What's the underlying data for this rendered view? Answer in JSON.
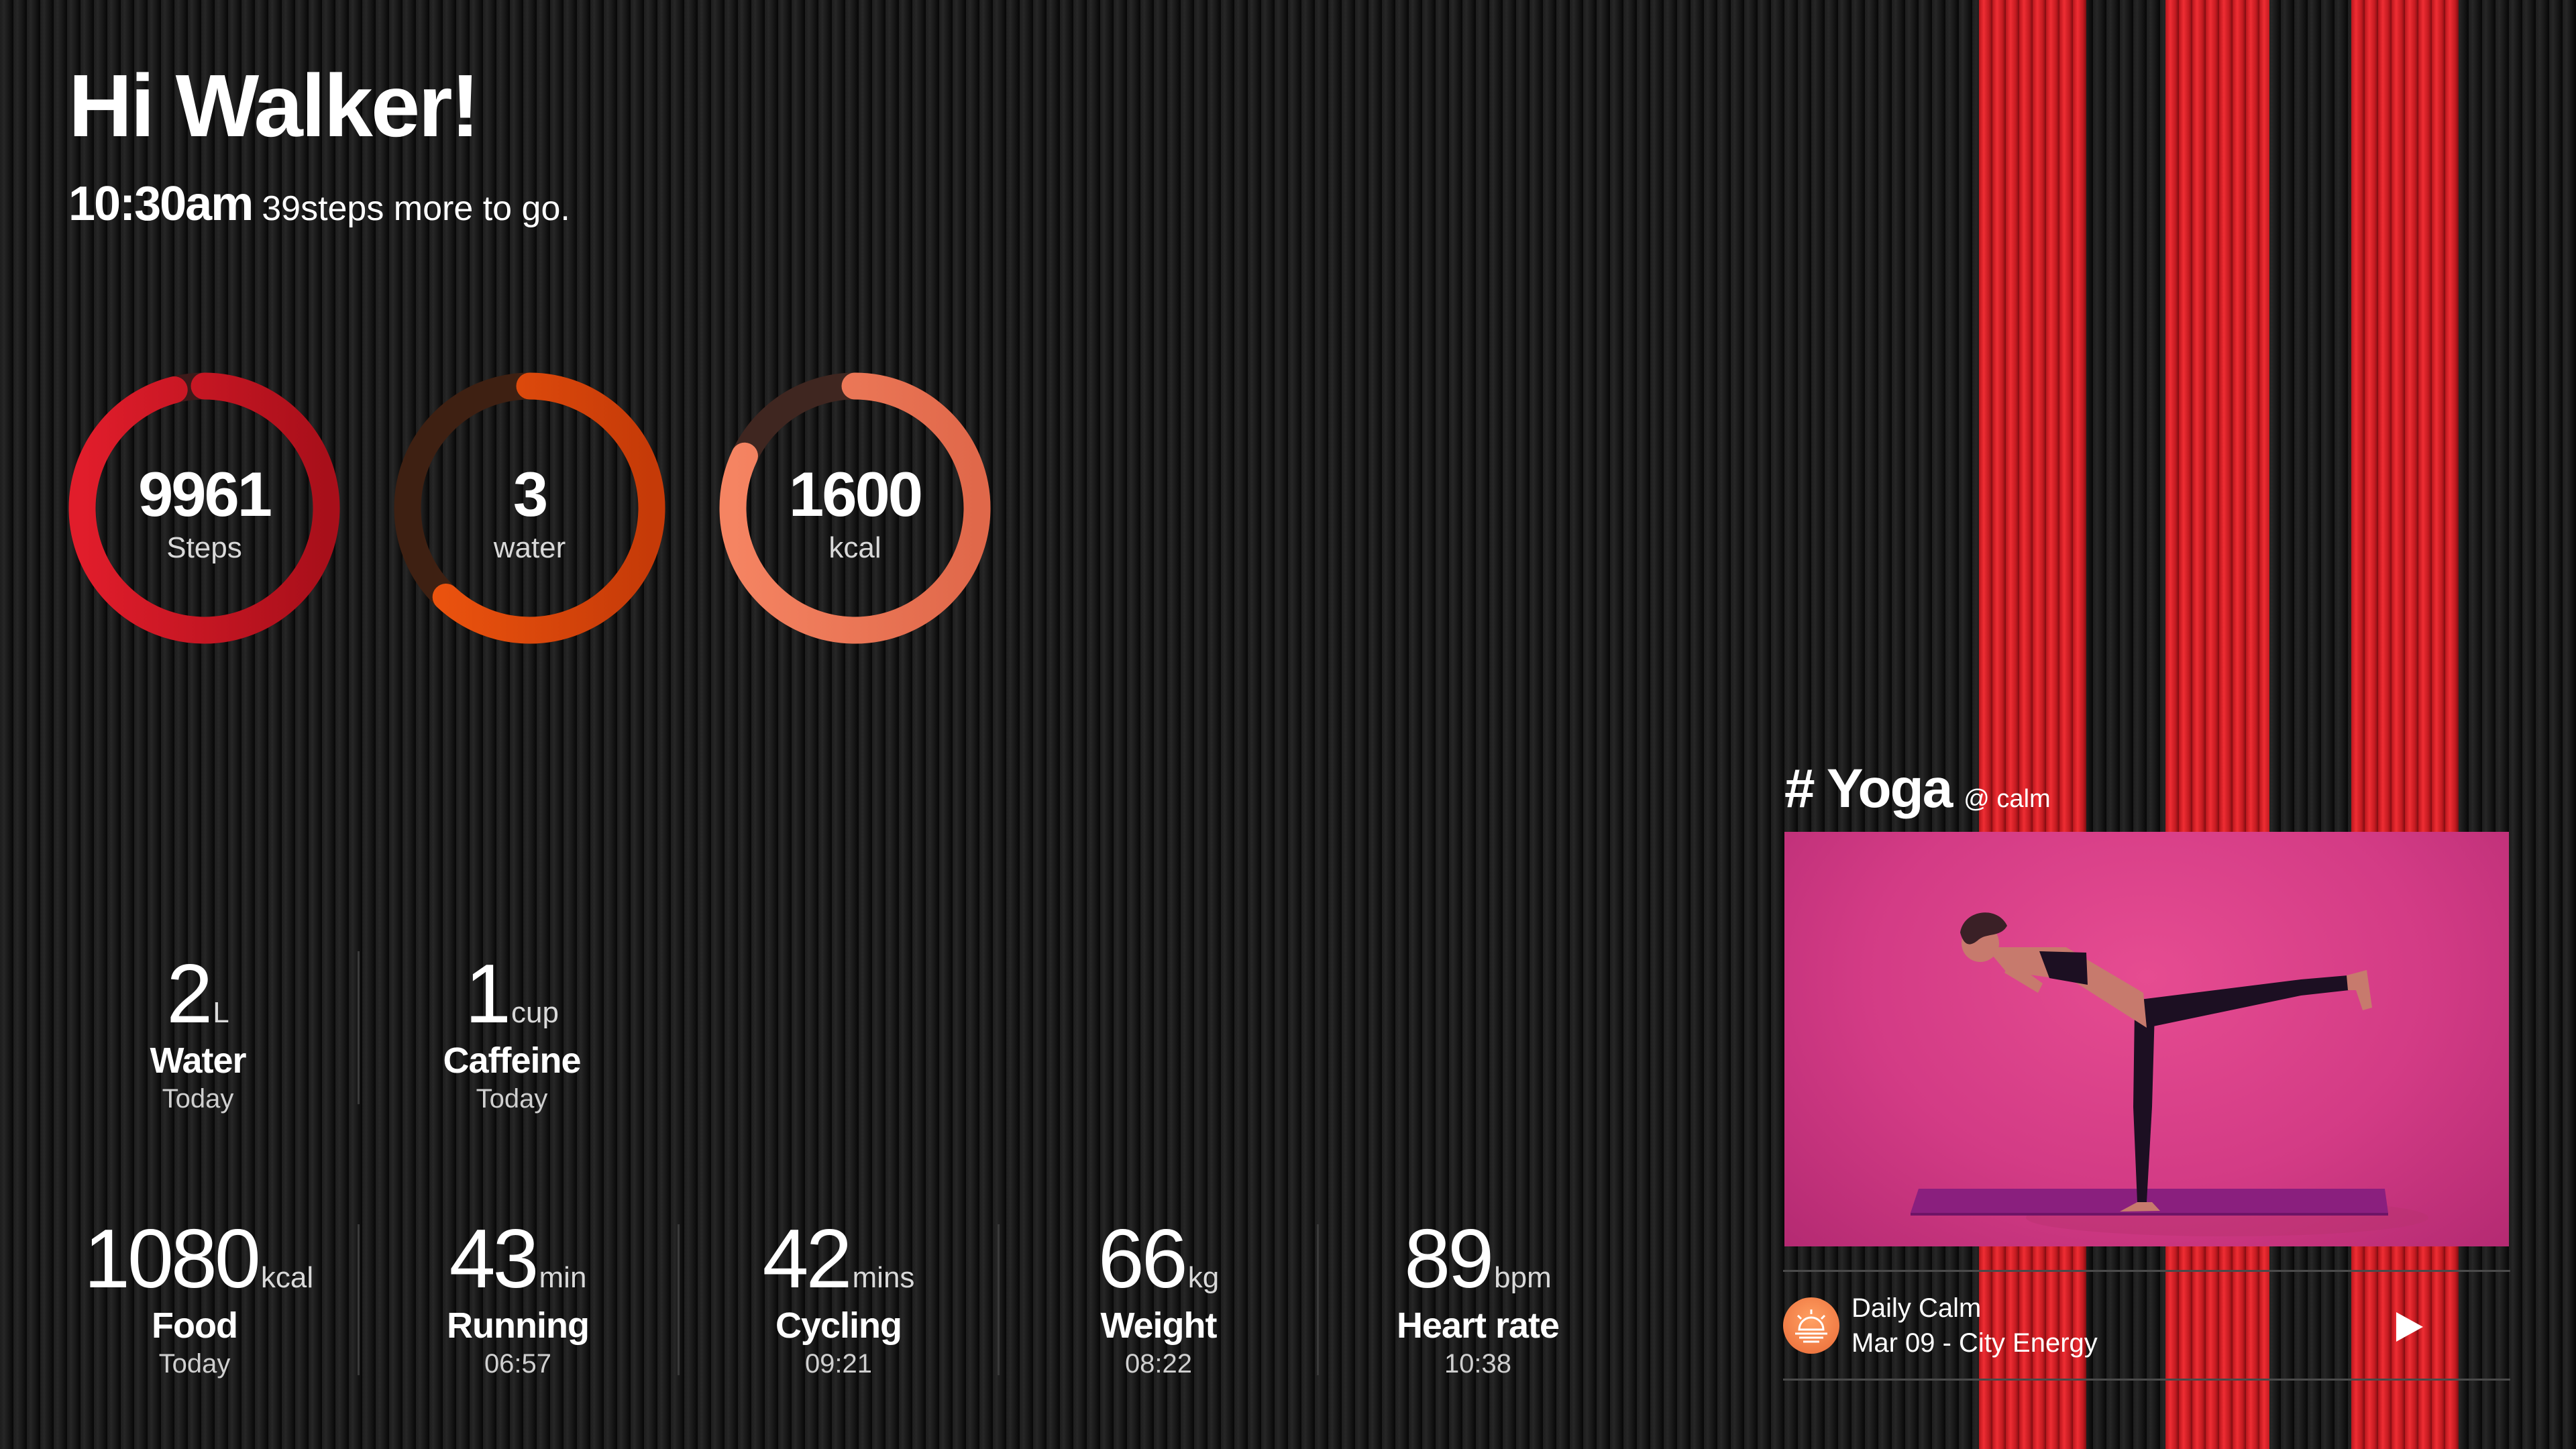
{
  "header": {
    "greeting": "Hi Walker!",
    "time": "10:30am",
    "steps_remaining": "39",
    "steps_text": "steps more to go."
  },
  "rings": [
    {
      "value": "9961",
      "label": "Steps",
      "progress": 0.96,
      "color": "#e11d2b"
    },
    {
      "value": "3",
      "label": "water",
      "progress": 0.62,
      "color": "#e0470d"
    },
    {
      "value": "1600",
      "label": "kcal",
      "progress": 0.82,
      "color": "#f27b55"
    }
  ],
  "stats_top": [
    {
      "value": "2",
      "unit": "L",
      "title": "Water",
      "sub": "Today"
    },
    {
      "value": "1",
      "unit": "cup",
      "title": "Caffeine",
      "sub": "Today"
    }
  ],
  "stats_bottom": [
    {
      "value": "1080",
      "unit": "kcal",
      "title": "Food",
      "sub": "Today"
    },
    {
      "value": "43",
      "unit": "min",
      "title": "Running",
      "sub": "06:57"
    },
    {
      "value": "42",
      "unit": "mins",
      "title": "Cycling",
      "sub": "09:21"
    },
    {
      "value": "66",
      "unit": "kg",
      "title": "Weight",
      "sub": "08:22"
    },
    {
      "value": "89",
      "unit": "bpm",
      "title": "Heart rate",
      "sub": "10:38"
    }
  ],
  "yoga": {
    "tag": "# Yoga",
    "handle": "@ calm",
    "item_title": "Daily Calm",
    "item_subtitle": "Mar 09 - City Energy"
  },
  "icons": {
    "app": "sun-icon",
    "play": "play-icon"
  },
  "colors": {
    "stripe_red": "#e52a31",
    "photo_pink": "#d63d87"
  }
}
